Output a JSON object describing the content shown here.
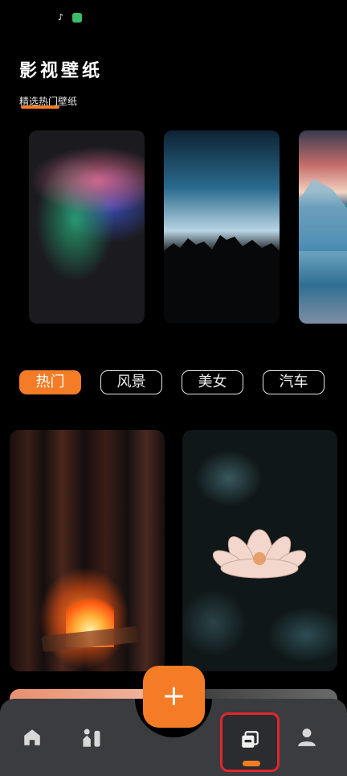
{
  "header": {
    "title": "影视壁纸",
    "subtitle": "精选热门壁纸"
  },
  "carousel": {
    "cards": [
      {
        "name": "aurora-gradient"
      },
      {
        "name": "mountain-silhouette"
      },
      {
        "name": "iceberg-lake"
      }
    ]
  },
  "categories": [
    {
      "label": "热门",
      "active": true
    },
    {
      "label": "风景",
      "active": false
    },
    {
      "label": "美女",
      "active": false
    },
    {
      "label": "汽车",
      "active": false
    }
  ],
  "fab": {
    "label": "+"
  },
  "nav": {
    "items": [
      {
        "icon": "home-icon"
      },
      {
        "icon": "rank-icon"
      },
      {
        "icon": "wallpaper-icon",
        "selected": true
      },
      {
        "icon": "user-icon"
      }
    ]
  },
  "colors": {
    "accent": "#f47c26",
    "highlight_border": "#e0262d",
    "nav_bg": "#3a3c3f"
  }
}
